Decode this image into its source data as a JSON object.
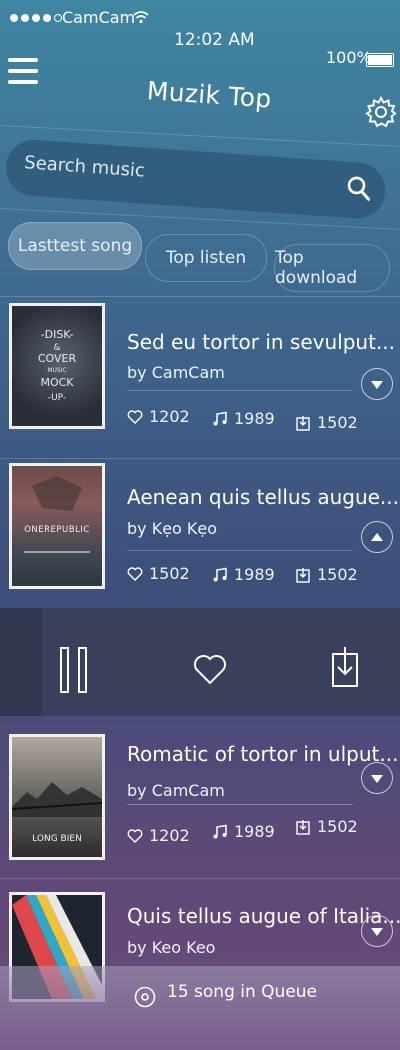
{
  "status_bar": {
    "carrier": "CamCam",
    "time": "12:02 AM",
    "battery": "100%",
    "signal_bars_filled": 4,
    "signal_bars_total": 5
  },
  "header": {
    "title": "Muzik Top",
    "menu_icon": "hamburger-menu-icon",
    "settings_icon": "gear-icon"
  },
  "search": {
    "placeholder": "Search music",
    "icon": "search-icon"
  },
  "tabs": [
    {
      "label": "Lasttest song",
      "active": true
    },
    {
      "label": "Top listen",
      "active": false
    },
    {
      "label": "Top download",
      "active": false
    }
  ],
  "songs": [
    {
      "title": "Sed eu tortor in sevulput...",
      "artist": "by CamCam",
      "likes": "1202",
      "plays": "1989",
      "downloads": "1502",
      "cover_text": [
        "-DISK-",
        "&",
        "COVER",
        "MUSIC",
        "MOCK",
        "-UP-"
      ],
      "toggle": "chevron-down-icon"
    },
    {
      "title": "Aenean quis tellus augue...",
      "artist": "by Kẹo Kẹo",
      "likes": "1502",
      "plays": "1989",
      "downloads": "1502",
      "cover_text": [
        "ONEREPUBLIC"
      ],
      "toggle": "chevron-up-icon"
    },
    {
      "title": "Romatic of tortor in ulput...",
      "artist": "by CamCam",
      "likes": "1202",
      "plays": "1989",
      "downloads": "1502",
      "cover_text": [
        "LONG BIEN"
      ],
      "toggle": "chevron-down-icon"
    },
    {
      "title": "Quis tellus augue of Italia...",
      "artist": "by Keo Keo",
      "toggle": "chevron-down-icon"
    }
  ],
  "player": {
    "pause_icon": "pause-icon",
    "heart_icon": "heart-icon",
    "download_icon": "download-icon"
  },
  "queue": {
    "text": "15 song in Queue",
    "icon": "disc-icon"
  }
}
